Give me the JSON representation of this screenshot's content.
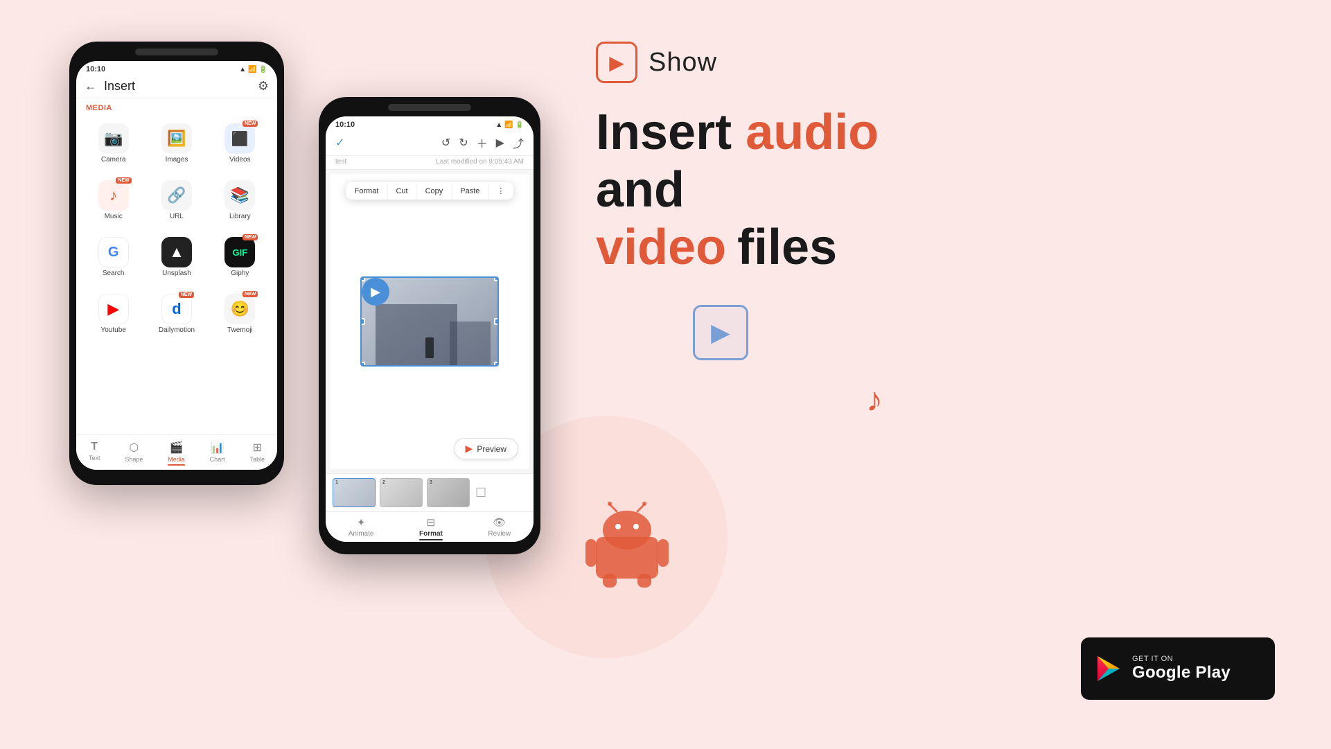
{
  "bg_color": "#fce8e6",
  "left_phone": {
    "status_time": "10:10",
    "title": "Insert",
    "section_media": "MEDIA",
    "icons_row1": [
      {
        "label": "Camera",
        "emoji": "📷",
        "badge": false
      },
      {
        "label": "Images",
        "emoji": "🖼️",
        "badge": false
      },
      {
        "label": "Videos",
        "emoji": "📹",
        "badge": true
      }
    ],
    "icons_row2": [
      {
        "label": "Music",
        "emoji": "🎵",
        "badge": true
      },
      {
        "label": "URL",
        "emoji": "🔗",
        "badge": false
      },
      {
        "label": "Library",
        "emoji": "📚",
        "badge": false
      }
    ],
    "icons_row3": [
      {
        "label": "Search",
        "emoji": "G",
        "badge": false,
        "google": true
      },
      {
        "label": "Unsplash",
        "emoji": "📸",
        "badge": false
      },
      {
        "label": "Giphy",
        "emoji": "🎞️",
        "badge": true
      }
    ],
    "icons_row4": [
      {
        "label": "Youtube",
        "emoji": "▶",
        "badge": false,
        "youtube": true
      },
      {
        "label": "Dailymotion",
        "emoji": "d",
        "badge": false,
        "daily": true
      },
      {
        "label": "Twemoji",
        "emoji": "😊",
        "badge": true
      }
    ],
    "tabs": [
      {
        "label": "Text",
        "icon": "T",
        "active": false
      },
      {
        "label": "Shape",
        "icon": "⬡",
        "active": false
      },
      {
        "label": "Media",
        "icon": "🎬",
        "active": true
      },
      {
        "label": "Chart",
        "icon": "📊",
        "active": false
      },
      {
        "label": "Table",
        "icon": "⊞",
        "active": false
      }
    ]
  },
  "right_phone": {
    "status_time": "10:10",
    "subtitle_left": "test",
    "subtitle_right": "Last modified on 9:05:43 AM",
    "context_menu": [
      "Format",
      "Cut",
      "Copy",
      "Paste"
    ],
    "video_label": "video",
    "preview_btn": "Preview",
    "footer_tabs": [
      {
        "label": "Animate",
        "active": false
      },
      {
        "label": "Format",
        "active": true
      },
      {
        "label": "Review",
        "active": false
      }
    ]
  },
  "brand": {
    "logo_icon": "▶",
    "name": "Show"
  },
  "headline": {
    "line1_plain": "Insert ",
    "line1_accent": "audio",
    "line2": "and",
    "line3_accent": "video",
    "line3_plain": " files"
  },
  "deco": {
    "video_icon": "▶",
    "music_icon": "♪"
  },
  "gplay": {
    "get_it": "GET IT ON",
    "store": "Google Play"
  }
}
